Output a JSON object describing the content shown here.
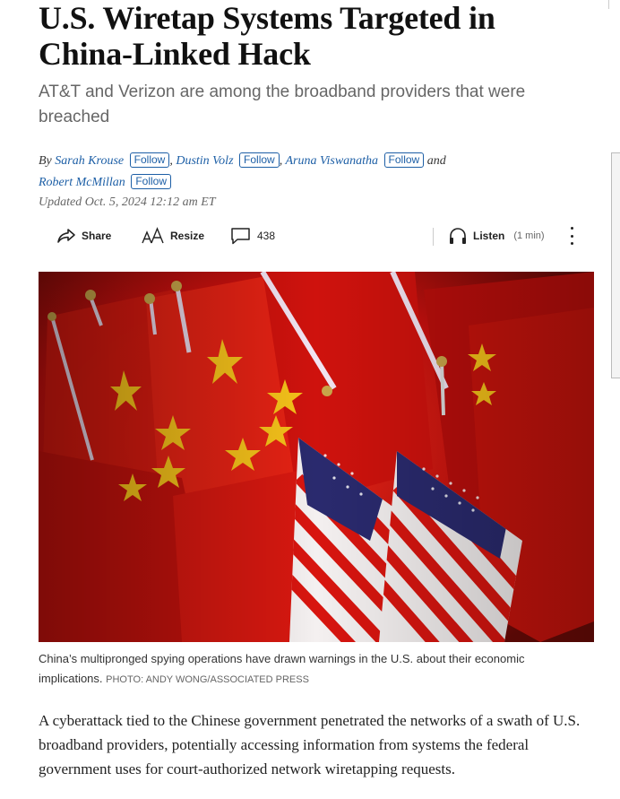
{
  "article": {
    "headline": "U.S. Wiretap Systems Targeted in China-Linked Hack",
    "dek": "AT&T and Verizon are among the broadband providers that were breached",
    "byline": {
      "prefix": "By",
      "authors": [
        "Sarah Krouse",
        "Dustin Volz",
        "Aruna Viswanatha",
        "Robert McMillan"
      ],
      "follow_label": "Follow",
      "sep": ",",
      "and": "and"
    },
    "dateline": "Updated Oct. 5, 2024 12:12 am ET"
  },
  "toolbar": {
    "share_label": "Share",
    "resize_label": "Resize",
    "comment_count": "438",
    "listen_label": "Listen",
    "listen_duration": "(1 min)"
  },
  "photo": {
    "caption": "China’s multipronged spying operations have drawn warnings in the U.S. about their economic implications.",
    "credit": "PHOTO: ANDY WONG/ASSOCIATED PRESS"
  },
  "body": {
    "first_paragraph": "A cyberattack tied to the Chinese government penetrated the networks of a swath of U.S. broadband providers, potentially accessing information from systems the federal government uses for court-authorized network wiretapping requests."
  },
  "icons": {
    "share": "share-arrow-icon",
    "resize": "text-resize-icon",
    "comments": "comment-bubble-icon",
    "listen": "headphones-icon",
    "more": "kebab-menu-icon"
  },
  "colors": {
    "link": "#1d5fa6",
    "flag_red": "#d9140f",
    "flag_blue": "#2a2a6e"
  }
}
